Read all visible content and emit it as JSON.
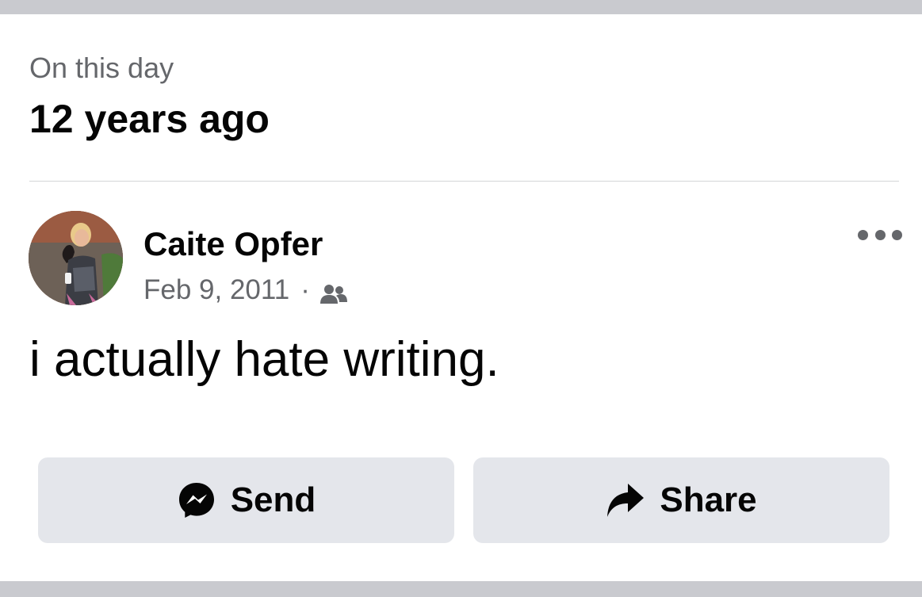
{
  "memory": {
    "label": "On this day",
    "heading": "12 years ago"
  },
  "post": {
    "author": "Caite Opfer",
    "date": "Feb 9, 2011",
    "separator": "·",
    "audience_icon": "friends-icon",
    "text": "i actually hate writing."
  },
  "actions": {
    "send_label": "Send",
    "send_icon": "messenger-icon",
    "share_label": "Share",
    "share_icon": "share-arrow-icon"
  },
  "colors": {
    "page_background": "#ffffff",
    "separator_bar": "#c9cacf",
    "secondary_text": "#65676b",
    "primary_text": "#050505",
    "button_background": "#e4e6eb"
  }
}
